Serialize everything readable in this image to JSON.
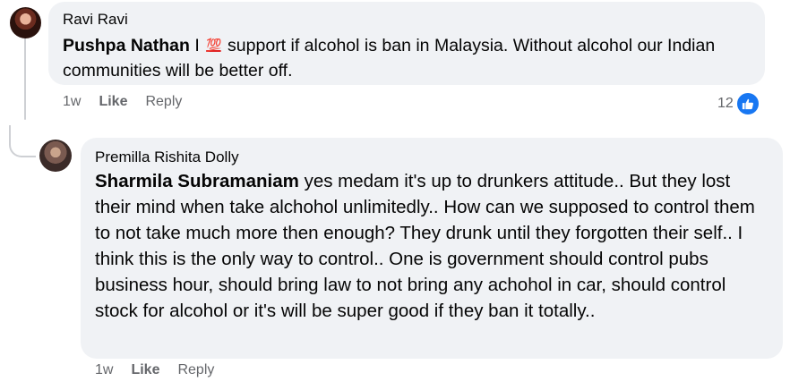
{
  "comments": [
    {
      "author": "Ravi Ravi",
      "mention": "Pushpa Nathan",
      "text_before_emoji": " I ",
      "emoji": "💯",
      "text_after_emoji": " support if alcohol is ban in Malaysia. Without alcohol our Indian communities will be better off.",
      "time": "1w",
      "like_label": "Like",
      "reply_label": "Reply",
      "reaction_count": "12",
      "reaction_icon": "like-icon"
    },
    {
      "author": "Premilla Rishita Dolly",
      "mention": "Sharmila Subramaniam",
      "text": " yes medam it's up to drunkers attitude.. But they lost their mind when take alchohol unlimitedly.. How can we supposed to control them to not take much more then enough? They drunk until they forgotten their self.. I think this is the only way to control.. One is government should control pubs business hour, should bring law to not bring any achohol in car, should control stock for alcohol or it's will be super good if they ban it totally..",
      "time": "1w",
      "like_label": "Like",
      "reply_label": "Reply"
    }
  ],
  "colors": {
    "bubble_bg": "#f0f2f5",
    "secondary_text": "#65676b",
    "like_blue": "#1877f2"
  }
}
